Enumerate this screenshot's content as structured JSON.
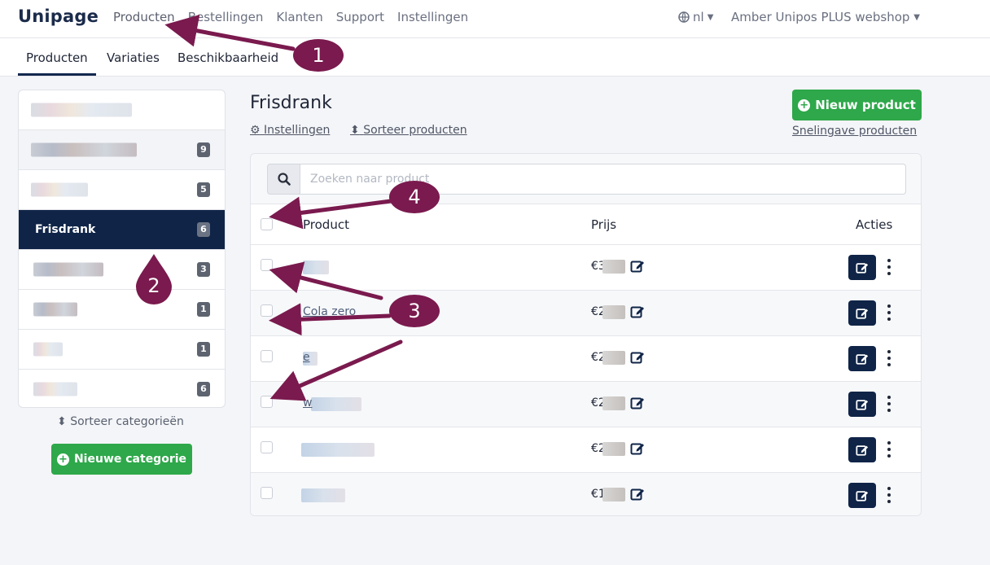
{
  "header": {
    "logo": "Unipage",
    "nav": [
      "Producten",
      "Bestellingen",
      "Klanten",
      "Support",
      "Instellingen"
    ],
    "language": "nl",
    "shop": "Amber Unipos PLUS webshop"
  },
  "subnav": {
    "tabs": [
      "Producten",
      "Variaties",
      "Beschikbaarheid"
    ]
  },
  "sidebar": {
    "categories": [
      {
        "name": "",
        "count": ""
      },
      {
        "name": "",
        "count": "9"
      },
      {
        "name": "",
        "count": "5"
      },
      {
        "name": "Frisdrank",
        "count": "6"
      },
      {
        "name": "",
        "count": "3"
      },
      {
        "name": "",
        "count": "1"
      },
      {
        "name": "",
        "count": "1"
      },
      {
        "name": "",
        "count": "6"
      }
    ],
    "sort_label": "Sorteer categorieën",
    "new_category_label": "Nieuwe categorie"
  },
  "main": {
    "title": "Frisdrank",
    "settings_link": "Instellingen",
    "sort_link": "Sorteer producten",
    "new_product_label": "Nieuw product",
    "quick_entry_link": "Snelingave producten",
    "search_placeholder": "Zoeken naar product",
    "columns": {
      "product": "Product",
      "price": "Prijs",
      "actions": "Acties"
    },
    "rows": [
      {
        "name": "",
        "price": "€3"
      },
      {
        "name": "Cola zero",
        "price": "€2"
      },
      {
        "name": "e",
        "price": "€2"
      },
      {
        "name": "w",
        "price": "€2"
      },
      {
        "name": "",
        "price": "€2"
      },
      {
        "name": "",
        "price": "€1"
      }
    ]
  },
  "annotations": [
    "1",
    "2",
    "3",
    "4"
  ],
  "colors": {
    "brand_dark": "#0f2447",
    "green": "#2ea84a",
    "callout": "#7a1a4e"
  }
}
